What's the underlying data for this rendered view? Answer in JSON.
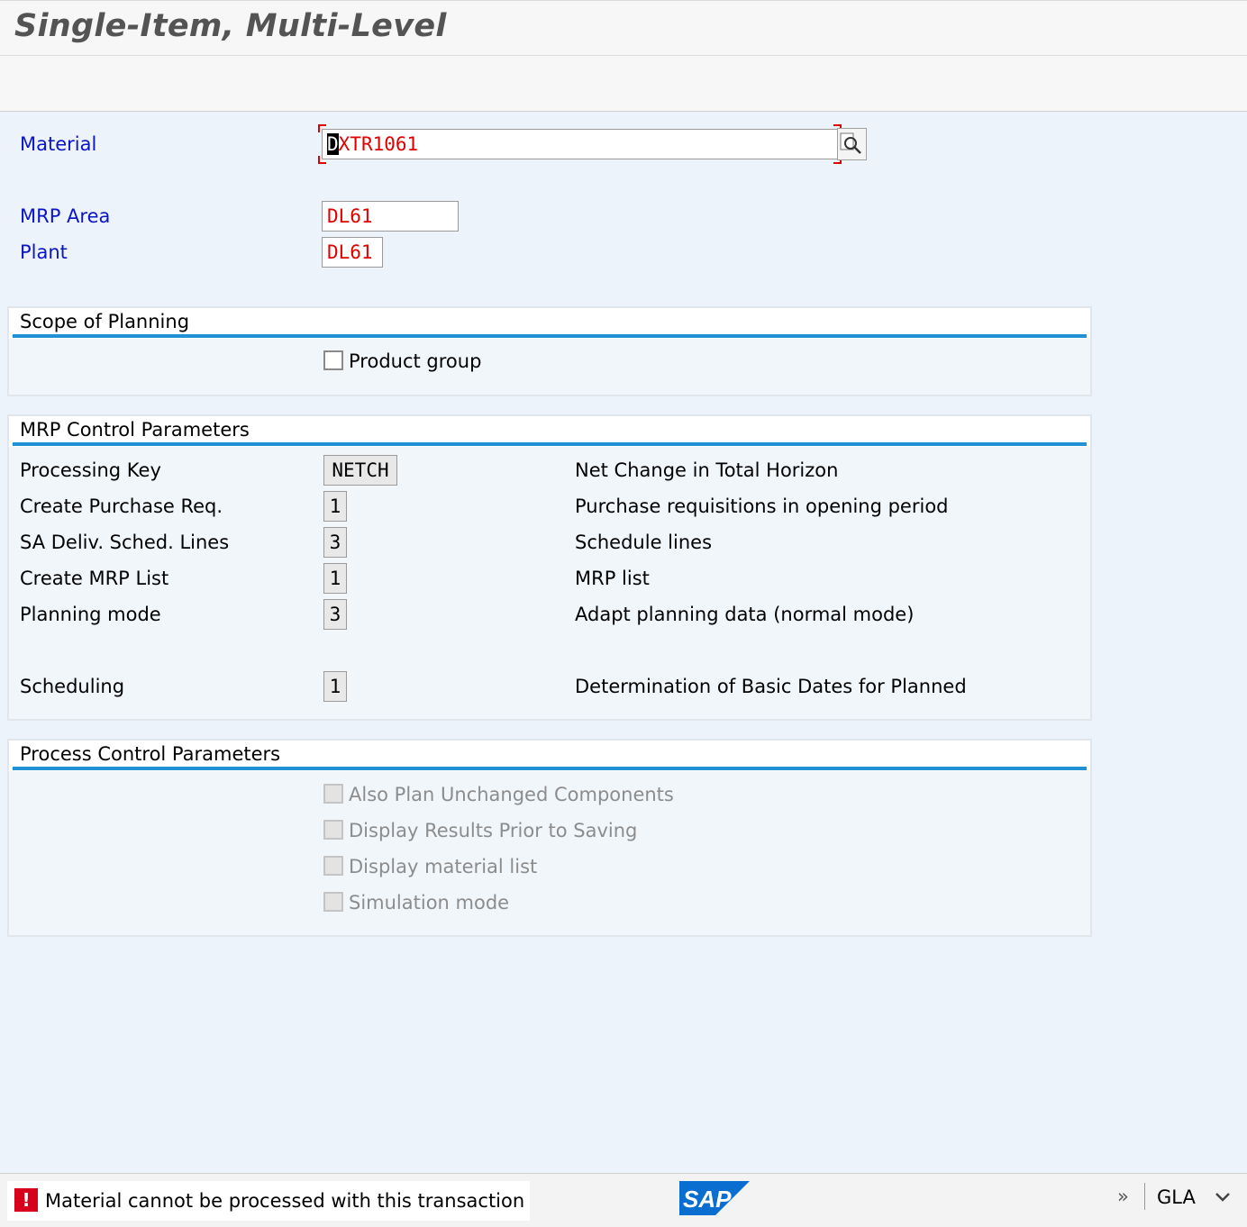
{
  "window": {
    "title": "Single-Item, Multi-Level"
  },
  "selection": {
    "material_label": "Material",
    "material_cursor_char": "D",
    "material_rest": "XTR1061",
    "mrp_area_label": "MRP Area",
    "mrp_area_value": "DL61",
    "plant_label": "Plant",
    "plant_value": "DL61",
    "search_icon": "search-icon"
  },
  "scope_of_planning": {
    "title": "Scope of Planning",
    "product_group_label": "Product group",
    "product_group_checked": false
  },
  "mrp_control": {
    "title": "MRP Control Parameters",
    "rows": [
      {
        "label": "Processing Key",
        "value": "NETCH",
        "description": "Net Change in Total Horizon"
      },
      {
        "label": "Create Purchase Req.",
        "value": "1",
        "description": "Purchase requisitions in opening period"
      },
      {
        "label": "SA Deliv. Sched. Lines",
        "value": "3",
        "description": "Schedule lines"
      },
      {
        "label": "Create MRP List",
        "value": "1",
        "description": "MRP list"
      },
      {
        "label": "Planning mode",
        "value": "3",
        "description": "Adapt planning data (normal mode)"
      },
      {
        "label": "Scheduling",
        "value": "1",
        "description": "Determination of Basic Dates for Planned"
      }
    ]
  },
  "process_control": {
    "title": "Process Control Parameters",
    "options": [
      {
        "label": "Also Plan Unchanged Components",
        "checked": false,
        "disabled": true
      },
      {
        "label": "Display Results Prior to Saving",
        "checked": false,
        "disabled": true
      },
      {
        "label": "Display material list",
        "checked": false,
        "disabled": true
      },
      {
        "label": "Simulation mode",
        "checked": false,
        "disabled": true
      }
    ]
  },
  "status_bar": {
    "message_type": "error",
    "error_icon_glyph": "!",
    "message": "Material cannot be processed with this transaction",
    "logo_text": "SAP",
    "system": "GLA",
    "expand_glyph": "»",
    "dropdown_icon": "chevron-down-icon"
  },
  "colors": {
    "label_blue": "#0a14c8",
    "input_red": "#e00000",
    "group_rule": "#2190d4",
    "error_red": "#d6001c",
    "sap_logo": "#0a6ed1"
  }
}
